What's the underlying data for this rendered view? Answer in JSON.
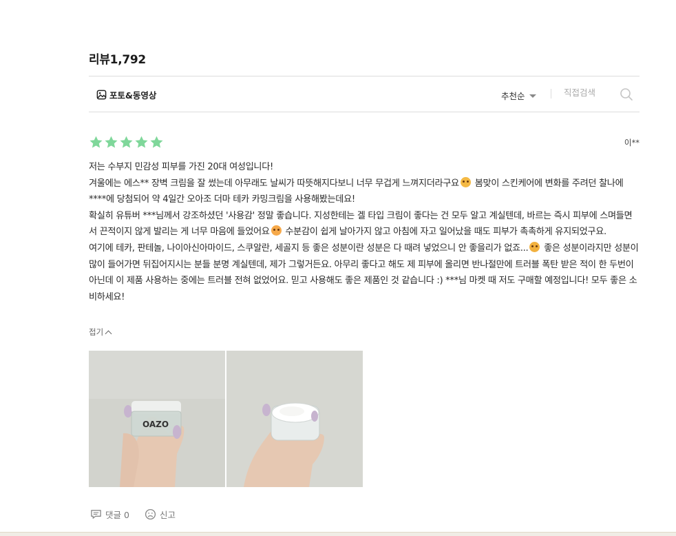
{
  "review_section": {
    "title": "리뷰1,792",
    "filter_label": "포토&동영상",
    "sort_label": "추천순",
    "search_placeholder": "직접검색"
  },
  "review": {
    "rating": 5,
    "star_color": "#7fd79a",
    "author": "이**",
    "paragraphs": [
      "저는 수부지 민감성 피부를 가진 20대 여성입니다!",
      "겨울에는 에스** 장벽 크림을 잘 썼는데 아무래도 날씨가 따뜻해지다보니 너무 무겁게 느껴지더라구요",
      "봄맞이 스킨케어에 변화를 주려던 찰나에 ****에 당첨되어 약 4일간 오아조 더마 테카 카밍크림을 사용해봤는데요!",
      "확실히 유튜버 ***님께서 강조하셨던 '사용감' 정말 좋습니다. 지성한테는 겔 타입 크림이 좋다는 건 모두 알고 계실텐데, 바르는 즉시 피부에 스며들면서 끈적이지 않게 발리는 게 너무 마음에 들었어요",
      "수분감이 쉽게 날아가지 않고 아침에 자고 일어났을 때도 피부가 촉촉하게 유지되었구요.",
      "여기에 테카, 판테놀, 나이아신아마이드, 스쿠알란, 세골지 등 좋은 성분이란 성분은 다 때려 넣었으니 안 좋을리가 없죠...",
      "좋은 성분이라지만 성분이 많이 들어가면 뒤집어지시는 분들 분명 계실텐데, 제가 그렇거든요. 아무리 좋다고 해도 제 피부에 올리면 반나절만에 트러블 폭탄 받은 적이 한 두번이 아닌데 이 제품 사용하는 중에는 트러블 전혀 없었어요. 믿고 사용해도 좋은 제품인 것 같습니다 :) ***님 마켓 때 저도 구매할 예정입니다! 모두 좋은 소비하세요!"
    ],
    "emoji_icons": [
      "flushed-face-icon",
      "crying-face-icon",
      "drooling-face-icon"
    ],
    "fold_label": "접기",
    "photos": [
      {
        "label": "OAZO",
        "subject": "cream jar closed lid held in hand"
      },
      {
        "label": "",
        "subject": "open cream jar with white cream held in hand"
      }
    ],
    "comment_label": "댓글 0",
    "report_label": "신고"
  }
}
